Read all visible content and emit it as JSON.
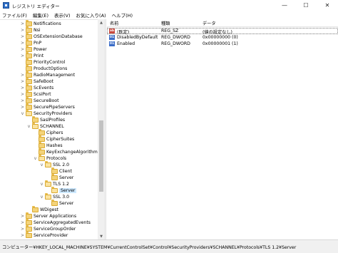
{
  "window": {
    "title": "レジストリ エディター",
    "minimize": "—",
    "maximize": "☐",
    "close": "✕"
  },
  "menu": [
    "ファイル(F)",
    "編集(E)",
    "表示(V)",
    "お気に入り(A)",
    "ヘルプ(H)"
  ],
  "tree": [
    {
      "label": "Notifications",
      "depth": 0,
      "exp": ">",
      "open": false,
      "selected": false
    },
    {
      "label": "Nsi",
      "depth": 0,
      "exp": ">",
      "open": false,
      "selected": false
    },
    {
      "label": "OSExtensionDatabase",
      "depth": 0,
      "exp": ">",
      "open": false,
      "selected": false
    },
    {
      "label": "PnP",
      "depth": 0,
      "exp": ">",
      "open": false,
      "selected": false
    },
    {
      "label": "Power",
      "depth": 0,
      "exp": ">",
      "open": false,
      "selected": false
    },
    {
      "label": "Print",
      "depth": 0,
      "exp": ">",
      "open": false,
      "selected": false
    },
    {
      "label": "PriorityControl",
      "depth": 0,
      "exp": "",
      "open": false,
      "selected": false
    },
    {
      "label": "ProductOptions",
      "depth": 0,
      "exp": "",
      "open": false,
      "selected": false
    },
    {
      "label": "RadioManagement",
      "depth": 0,
      "exp": ">",
      "open": false,
      "selected": false
    },
    {
      "label": "SafeBoot",
      "depth": 0,
      "exp": ">",
      "open": false,
      "selected": false
    },
    {
      "label": "ScEvents",
      "depth": 0,
      "exp": ">",
      "open": false,
      "selected": false
    },
    {
      "label": "ScsiPort",
      "depth": 0,
      "exp": ">",
      "open": false,
      "selected": false
    },
    {
      "label": "SecureBoot",
      "depth": 0,
      "exp": ">",
      "open": false,
      "selected": false
    },
    {
      "label": "SecurePipeServers",
      "depth": 0,
      "exp": ">",
      "open": false,
      "selected": false
    },
    {
      "label": "SecurityProviders",
      "depth": 0,
      "exp": "v",
      "open": true,
      "selected": false
    },
    {
      "label": "SaslProfiles",
      "depth": 1,
      "exp": "",
      "open": false,
      "selected": false
    },
    {
      "label": "SCHANNEL",
      "depth": 1,
      "exp": "v",
      "open": true,
      "selected": false
    },
    {
      "label": "Ciphers",
      "depth": 2,
      "exp": "",
      "open": false,
      "selected": false
    },
    {
      "label": "CipherSuites",
      "depth": 2,
      "exp": "",
      "open": false,
      "selected": false
    },
    {
      "label": "Hashes",
      "depth": 2,
      "exp": "",
      "open": false,
      "selected": false
    },
    {
      "label": "KeyExchangeAlgorithms",
      "depth": 2,
      "exp": "",
      "open": false,
      "selected": false
    },
    {
      "label": "Protocols",
      "depth": 2,
      "exp": "v",
      "open": true,
      "selected": false
    },
    {
      "label": "SSL 2.0",
      "depth": 3,
      "exp": "v",
      "open": true,
      "selected": false
    },
    {
      "label": "Client",
      "depth": 4,
      "exp": "",
      "open": false,
      "selected": false
    },
    {
      "label": "Server",
      "depth": 4,
      "exp": "",
      "open": false,
      "selected": false
    },
    {
      "label": "TLS 1.2",
      "depth": 3,
      "exp": "v",
      "open": true,
      "selected": false
    },
    {
      "label": "Server",
      "depth": 4,
      "exp": "",
      "open": true,
      "selected": true
    },
    {
      "label": "SSL 3.0",
      "depth": 3,
      "exp": "v",
      "open": true,
      "selected": false
    },
    {
      "label": "Server",
      "depth": 4,
      "exp": "",
      "open": false,
      "selected": false
    },
    {
      "label": "WDigest",
      "depth": 1,
      "exp": "",
      "open": false,
      "selected": false
    },
    {
      "label": "Server Applications",
      "depth": 0,
      "exp": ">",
      "open": false,
      "selected": false
    },
    {
      "label": "ServiceAggregatedEvents",
      "depth": 0,
      "exp": ">",
      "open": false,
      "selected": false
    },
    {
      "label": "ServiceGroupOrder",
      "depth": 0,
      "exp": ">",
      "open": false,
      "selected": false
    },
    {
      "label": "ServiceProvider",
      "depth": 0,
      "exp": ">",
      "open": false,
      "selected": false
    }
  ],
  "list": {
    "headers": {
      "name": "名前",
      "type": "種類",
      "data": "データ"
    },
    "rows": [
      {
        "icon": "ab",
        "kind": "sz",
        "name": "(既定)",
        "type": "REG_SZ",
        "data": "(値の設定なし)",
        "focused": true
      },
      {
        "icon": "01",
        "kind": "dw",
        "name": "DisabledByDefault",
        "type": "REG_DWORD",
        "data": "0x00000000 (0)",
        "focused": false
      },
      {
        "icon": "01",
        "kind": "dw",
        "name": "Enabled",
        "type": "REG_DWORD",
        "data": "0x00000001 (1)",
        "focused": false
      }
    ]
  },
  "status": {
    "path": "コンピューター¥HKEY_LOCAL_MACHINE¥SYSTEM¥CurrentControlSet¥Control¥SecurityProviders¥SCHANNEL¥Protocols¥TLS 1.2¥Server"
  },
  "icons": {
    "app": "registry-icon",
    "folder": "folder-icon",
    "string_value": "string-value-icon",
    "dword_value": "dword-value-icon",
    "scroll_up": "▲",
    "scroll_down": "▼"
  }
}
